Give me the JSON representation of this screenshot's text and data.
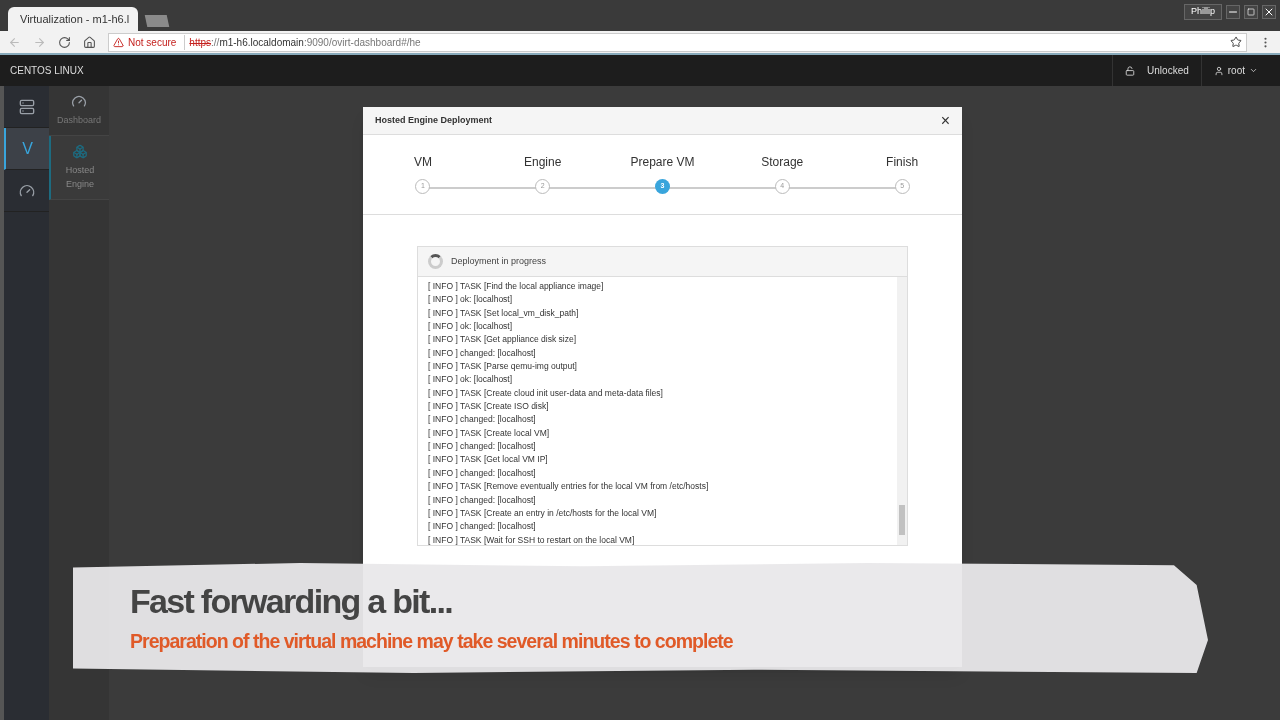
{
  "browser": {
    "tab_title": "Virtualization - m1-h6.l",
    "security": "Not secure",
    "url_scheme": "https",
    "url_sep": "://",
    "url_host": "m1-h6.localdomain",
    "url_rest": ":9090/ovirt-dashboard#/he",
    "profile": "Phillip"
  },
  "topbar": {
    "brand": "CENTOS LINUX",
    "lock": "Unlocked",
    "user": "root"
  },
  "rail": [
    {
      "kind": "host",
      "selected": false
    },
    {
      "kind": "letter",
      "label": "V",
      "selected": true
    },
    {
      "kind": "gauge",
      "selected": false
    }
  ],
  "subnav": [
    {
      "kind": "gauge",
      "label": "Dashboard",
      "selected": false
    },
    {
      "kind": "cubes",
      "label": "Hosted Engine",
      "selected": true
    }
  ],
  "modal": {
    "title": "Hosted Engine Deployment",
    "close": "×",
    "steps": [
      {
        "label": "VM",
        "number": "1",
        "selected": false
      },
      {
        "label": "Engine",
        "number": "2",
        "selected": false
      },
      {
        "label": "Prepare VM",
        "number": "3",
        "selected": true
      },
      {
        "label": "Storage",
        "number": "4",
        "selected": false
      },
      {
        "label": "Finish",
        "number": "5",
        "selected": false
      }
    ],
    "status": "Deployment in progress",
    "log": [
      "[ INFO ] TASK [Find the local appliance image]",
      "[ INFO ] ok: [localhost]",
      "[ INFO ] TASK [Set local_vm_disk_path]",
      "[ INFO ] ok: [localhost]",
      "[ INFO ] TASK [Get appliance disk size]",
      "[ INFO ] changed: [localhost]",
      "[ INFO ] TASK [Parse qemu-img output]",
      "[ INFO ] ok: [localhost]",
      "[ INFO ] TASK [Create cloud init user-data and meta-data files]",
      "[ INFO ] TASK [Create ISO disk]",
      "[ INFO ] changed: [localhost]",
      "[ INFO ] TASK [Create local VM]",
      "[ INFO ] changed: [localhost]",
      "[ INFO ] TASK [Get local VM IP]",
      "[ INFO ] changed: [localhost]",
      "[ INFO ] TASK [Remove eventually entries for the local VM from /etc/hosts]",
      "[ INFO ] changed: [localhost]",
      "[ INFO ] TASK [Create an entry in /etc/hosts for the local VM]",
      "[ INFO ] changed: [localhost]",
      "[ INFO ] TASK [Wait for SSH to restart on the local VM]"
    ]
  },
  "banner": {
    "heading": "Fast forwarding a bit...",
    "subheading": "Preparation of the virtual machine may take several minutes to complete"
  }
}
